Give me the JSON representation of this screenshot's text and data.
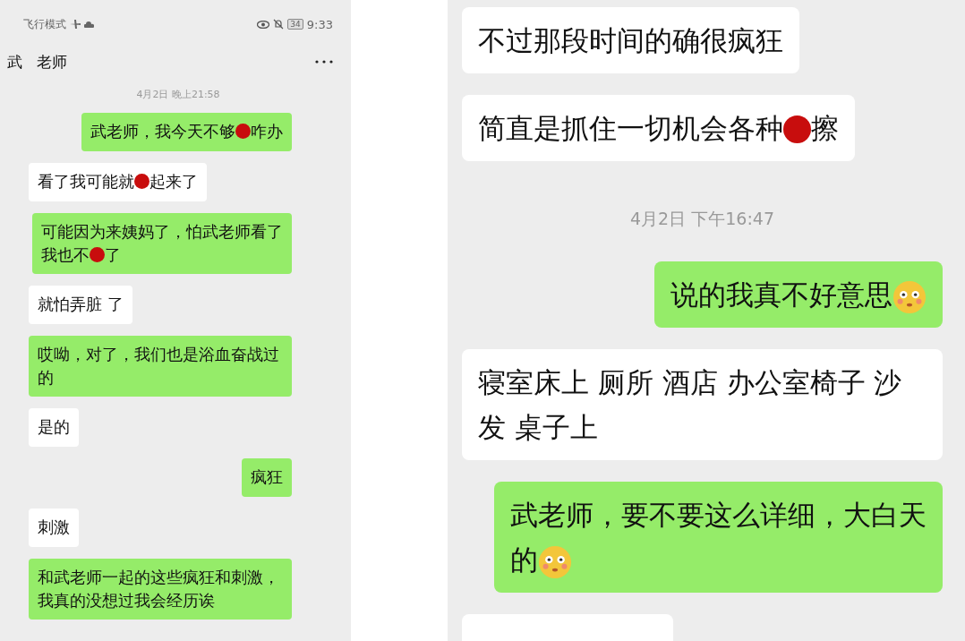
{
  "left_screen": {
    "status_bar": {
      "mode": "飞行模式",
      "battery": "34",
      "time": "9:33"
    },
    "chat_title": "武   老师",
    "messages": [
      {
        "kind": "time",
        "text": "4月2日 晚上21:58"
      },
      {
        "kind": "bubble",
        "sent": true,
        "parts": [
          {
            "kind": "text",
            "text": "武老师，我今天不够"
          },
          {
            "kind": "redacted"
          },
          {
            "kind": "text",
            "text": "咋办"
          }
        ]
      },
      {
        "kind": "bubble",
        "sent": false,
        "parts": [
          {
            "kind": "text",
            "text": "看了我可能就"
          },
          {
            "kind": "redacted"
          },
          {
            "kind": "text",
            "text": "起来了"
          }
        ]
      },
      {
        "kind": "bubble",
        "sent": true,
        "lines": [
          [
            {
              "kind": "text",
              "text": "可能因为来姨妈了，怕武老师看了"
            }
          ],
          [
            {
              "kind": "text",
              "text": "我也不"
            },
            {
              "kind": "redacted"
            },
            {
              "kind": "text",
              "text": "了"
            }
          ]
        ]
      },
      {
        "kind": "bubble",
        "sent": false,
        "parts": [
          {
            "kind": "text",
            "text": "就怕弄脏 了"
          }
        ]
      },
      {
        "kind": "bubble",
        "sent": true,
        "parts": [
          {
            "kind": "text",
            "text": "哎呦，对了，我们也是浴血奋战过的"
          }
        ]
      },
      {
        "kind": "bubble",
        "sent": false,
        "parts": [
          {
            "kind": "text",
            "text": "是的"
          }
        ]
      },
      {
        "kind": "bubble",
        "sent": true,
        "parts": [
          {
            "kind": "text",
            "text": "疯狂"
          }
        ]
      },
      {
        "kind": "bubble",
        "sent": false,
        "parts": [
          {
            "kind": "text",
            "text": "刺激"
          }
        ]
      },
      {
        "kind": "bubble",
        "sent": true,
        "parts": [
          {
            "kind": "text",
            "text": "和武老师一起的这些疯狂和刺激，我真的没想过我会经历诶"
          }
        ]
      }
    ]
  },
  "right_screen": {
    "messages": [
      {
        "kind": "bubble",
        "sent": false,
        "parts": [
          {
            "kind": "text",
            "text": "不过那段时间的确很疯狂"
          }
        ]
      },
      {
        "kind": "bubble",
        "sent": false,
        "parts": [
          {
            "kind": "text",
            "text": "简直是抓住一切机会各种"
          },
          {
            "kind": "redacted"
          },
          {
            "kind": "text",
            "text": "擦"
          }
        ]
      },
      {
        "kind": "time",
        "text": "4月2日 下午16:47"
      },
      {
        "kind": "bubble",
        "sent": true,
        "parts": [
          {
            "kind": "text",
            "text": "说的我真不好意思"
          },
          {
            "kind": "emoji"
          }
        ]
      },
      {
        "kind": "bubble",
        "sent": false,
        "parts": [
          {
            "kind": "text",
            "text": "寝室床上 厕所 酒店 办公室椅子 沙发 桌子上"
          }
        ]
      },
      {
        "kind": "bubble",
        "sent": true,
        "lines": [
          [
            {
              "kind": "text",
              "text": "武老师，要不要这么详细，大白天"
            }
          ],
          [
            {
              "kind": "text",
              "text": "的"
            },
            {
              "kind": "emoji"
            }
          ]
        ]
      },
      {
        "kind": "clipped",
        "sent": false
      }
    ]
  }
}
